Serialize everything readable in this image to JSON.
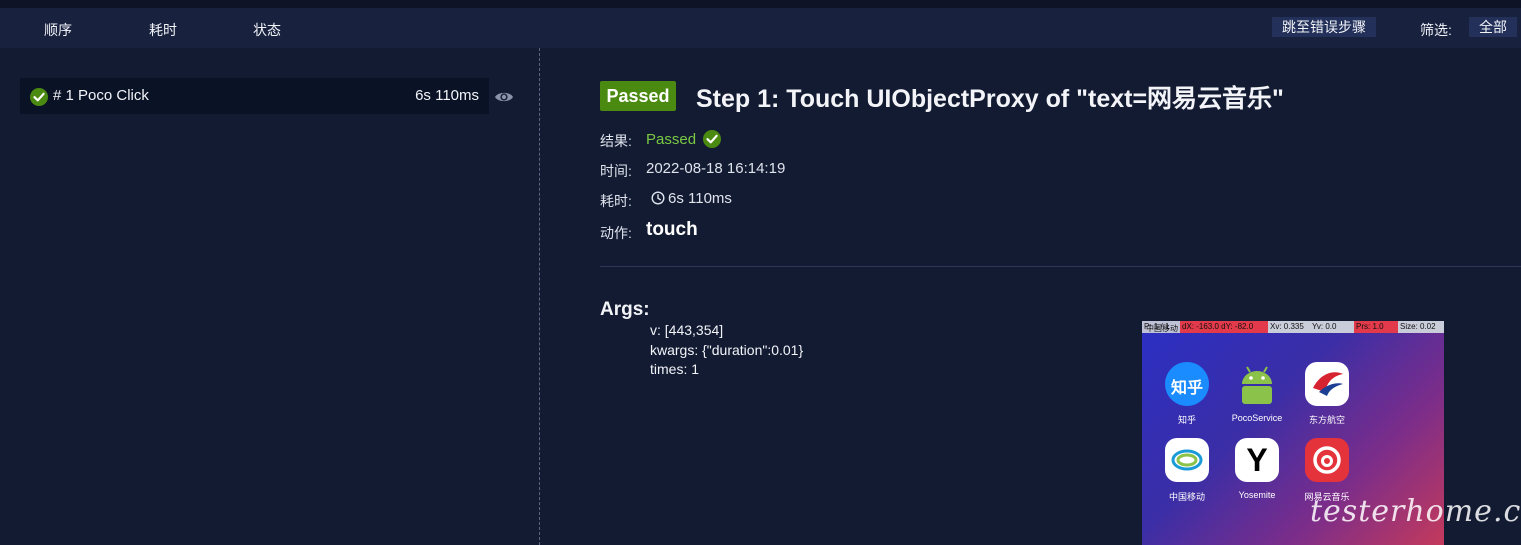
{
  "header": {
    "col_order": "顺序",
    "col_time": "耗时",
    "col_status": "状态",
    "jump_error": "跳至错误步骤",
    "filter_label": "筛选:",
    "filter_value": "全部"
  },
  "steps": [
    {
      "label": "# 1 Poco Click",
      "duration": "6s 110ms",
      "status": "passed"
    }
  ],
  "detail": {
    "badge": "Passed",
    "title": "Step 1: Touch UIObjectProxy of \"text=网易云音乐\"",
    "result_label": "结果:",
    "result_value": "Passed",
    "time_label": "时间:",
    "time_value": "2022-08-18 16:14:19",
    "duration_label": "耗时:",
    "duration_value": "6s 110ms",
    "action_label": "动作:",
    "action_value": "touch",
    "args_title": "Args:",
    "args": [
      "v: [443,354]",
      "kwargs: {\"duration\":0.01}",
      "times: 1"
    ]
  },
  "screenshot": {
    "statusbar": [
      "P: 1 / 1",
      "dX: -163.0 dY: -82.0",
      "Xv: 0.335",
      "Yv: 0.0",
      "Prs: 1.0",
      "Size: 0.02"
    ],
    "carrier": "中国移动",
    "apps": [
      {
        "name": "知乎",
        "icon": "zhihu-icon",
        "glyph": "知乎"
      },
      {
        "name": "PocoService",
        "icon": "android-icon",
        "glyph": ""
      },
      {
        "name": "东方航空",
        "icon": "china-eastern-icon",
        "glyph": ""
      },
      {
        "name": "中国移动",
        "icon": "china-mobile-icon",
        "glyph": ""
      },
      {
        "name": "Yosemite",
        "icon": "yosemite-icon",
        "glyph": "Y"
      },
      {
        "name": "网易云音乐",
        "icon": "netease-music-icon",
        "glyph": ""
      }
    ]
  },
  "watermark": "testerhome.com",
  "colors": {
    "accent_pass": "#4b8a10",
    "pass_text": "#7ac943",
    "background": "#131b33",
    "header_bg": "#18223f"
  }
}
